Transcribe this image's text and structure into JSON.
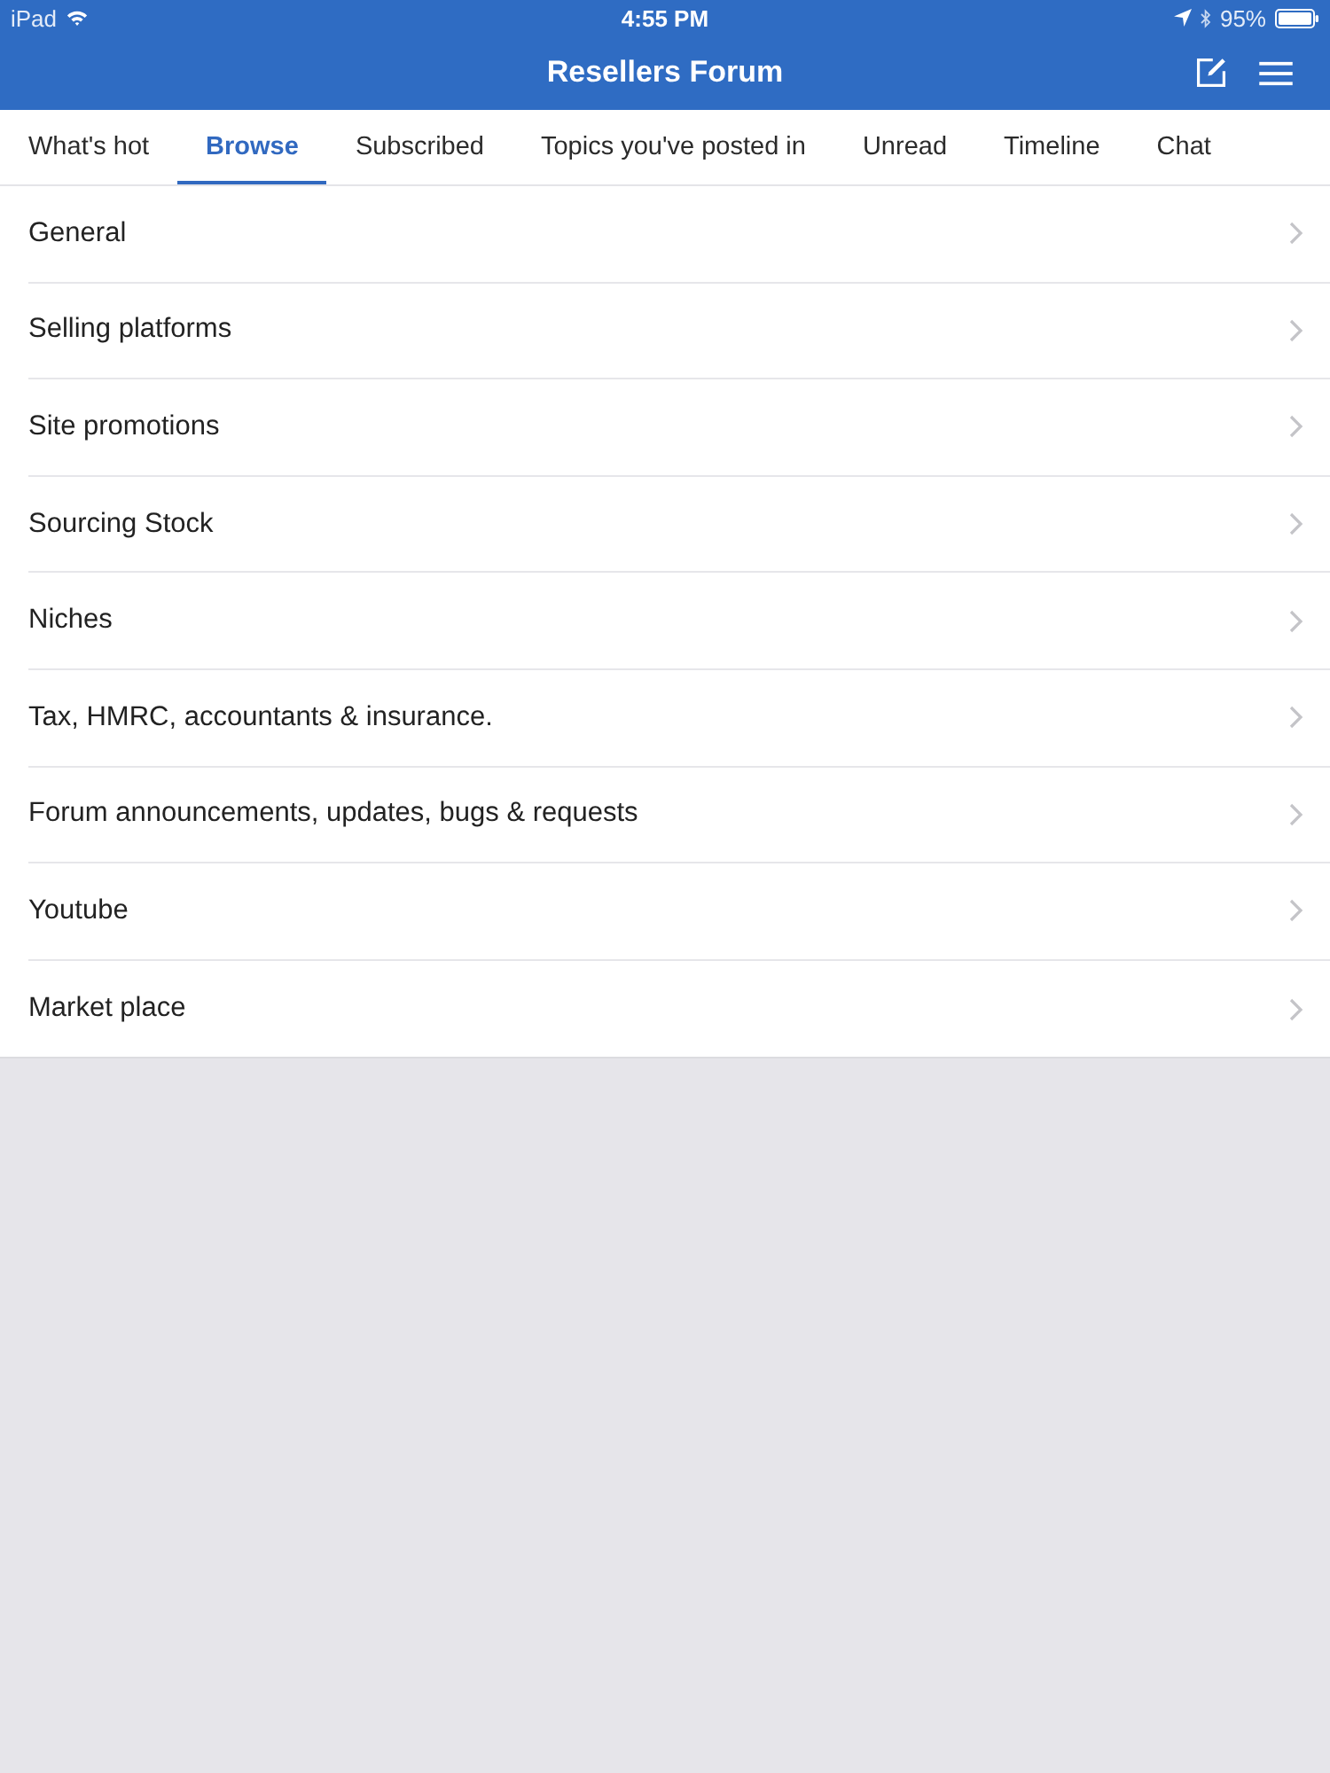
{
  "status_bar": {
    "device": "iPad",
    "time": "4:55 PM",
    "battery": "95%"
  },
  "nav_bar": {
    "title": "Resellers Forum"
  },
  "tabs": [
    {
      "label": "What's hot",
      "selected": false
    },
    {
      "label": "Browse",
      "selected": true
    },
    {
      "label": "Subscribed",
      "selected": false
    },
    {
      "label": "Topics you've posted in",
      "selected": false
    },
    {
      "label": "Unread",
      "selected": false
    },
    {
      "label": "Timeline",
      "selected": false
    },
    {
      "label": "Chat",
      "selected": false
    }
  ],
  "forums": [
    {
      "title": "General"
    },
    {
      "title": "Selling platforms"
    },
    {
      "title": "Site promotions"
    },
    {
      "title": "Sourcing Stock"
    },
    {
      "title": "Niches"
    },
    {
      "title": "Tax, HMRC, accountants & insurance."
    },
    {
      "title": "Forum announcements, updates, bugs & requests"
    },
    {
      "title": "Youtube"
    },
    {
      "title": "Market place"
    }
  ]
}
